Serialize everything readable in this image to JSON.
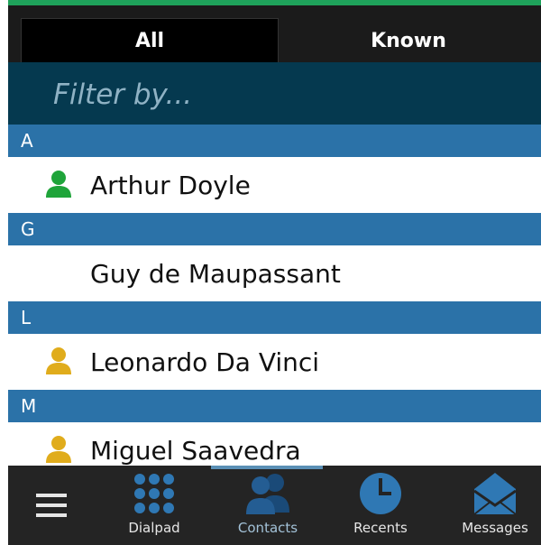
{
  "header": {
    "tabs": [
      {
        "label": "All",
        "selected": true
      },
      {
        "label": "Known",
        "selected": false
      }
    ]
  },
  "filter": {
    "placeholder": "Filter by..."
  },
  "sections": [
    {
      "letter": "A",
      "contacts": [
        {
          "name": "Arthur Doyle",
          "icon": "person-icon",
          "icon_color": "#1fa43a"
        }
      ]
    },
    {
      "letter": "G",
      "contacts": [
        {
          "name": "Guy de Maupassant",
          "icon": "",
          "icon_color": ""
        }
      ]
    },
    {
      "letter": "L",
      "contacts": [
        {
          "name": "Leonardo Da Vinci",
          "icon": "person-icon",
          "icon_color": "#e0ac1c"
        }
      ]
    },
    {
      "letter": "M",
      "contacts": [
        {
          "name": "Miguel Saavedra",
          "icon": "person-icon",
          "icon_color": "#e0ac1c"
        }
      ]
    }
  ],
  "tabbar": {
    "menu_icon": "hamburger-menu-icon",
    "items": [
      {
        "label": "Dialpad",
        "icon": "dialpad-icon"
      },
      {
        "label": "Contacts",
        "icon": "contacts-icon",
        "active": true
      },
      {
        "label": "Recents",
        "icon": "clock-icon"
      },
      {
        "label": "Messages",
        "icon": "envelope-icon"
      }
    ]
  },
  "colors": {
    "accent_green": "#1fa25b",
    "filter_bg": "#05394f",
    "section_bg": "#2b72a8",
    "tab_icon_blue": "#2f78b4"
  }
}
